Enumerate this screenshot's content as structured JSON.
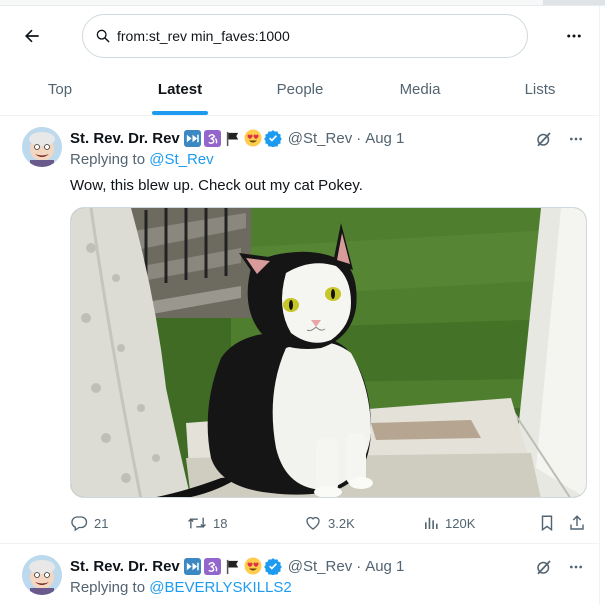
{
  "search": {
    "query": "from:st_rev min_faves:1000"
  },
  "tabs": [
    {
      "label": "Top"
    },
    {
      "label": "Latest"
    },
    {
      "label": "People"
    },
    {
      "label": "Media"
    },
    {
      "label": "Lists"
    }
  ],
  "active_tab": "Latest",
  "tweets": [
    {
      "author_name": "St. Rev. Dr. Rev",
      "name_emojis": [
        "fast-forward-emoji",
        "om-symbol-emoji",
        "black-flag-emoji",
        "heart-eyes-emoji"
      ],
      "handle": "@St_Rev",
      "separator": "·",
      "date": "Aug 1",
      "replying_prefix": "Replying to",
      "replying_to": "@St_Rev",
      "text": "Wow, this blew up. Check out my cat Pokey.",
      "media_alt": "black-and-white cat sitting in a window",
      "replies": "21",
      "reposts": "18",
      "likes": "3.2K",
      "views": "120K"
    },
    {
      "author_name": "St. Rev. Dr. Rev",
      "name_emojis": [
        "fast-forward-emoji",
        "om-symbol-emoji",
        "black-flag-emoji",
        "heart-eyes-emoji"
      ],
      "handle": "@St_Rev",
      "separator": "·",
      "date": "Aug 1",
      "replying_prefix": "Replying to",
      "replying_to": "@BEVERLYSKILLS2"
    }
  ],
  "colors": {
    "accent": "#1d9bf0",
    "muted": "#536471",
    "text": "#0f1419",
    "verified": "#1d9bf0"
  }
}
